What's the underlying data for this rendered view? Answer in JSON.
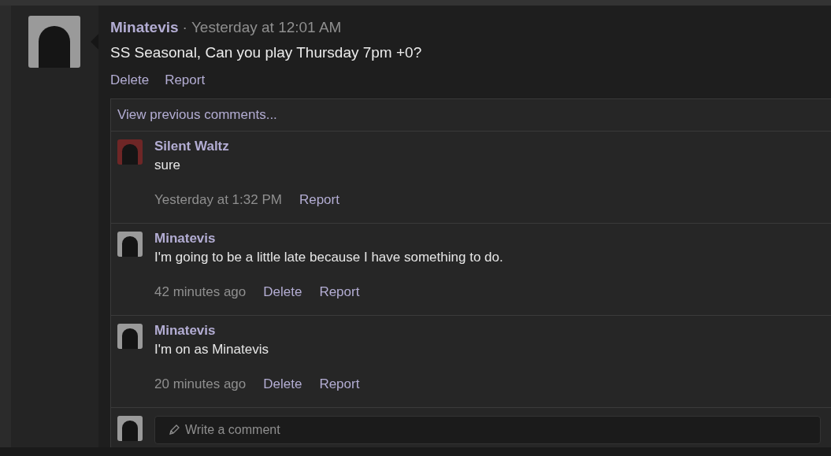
{
  "post": {
    "author": "Minatevis",
    "separator": "·",
    "time": "Yesterday at 12:01 AM",
    "text": "SS Seasonal, Can you play Thursday 7pm +0?",
    "actions": [
      "Delete",
      "Report"
    ]
  },
  "comments": {
    "view_previous": "View previous comments...",
    "items": [
      {
        "author": "Silent Waltz",
        "color": "#6e2626",
        "text": "sure",
        "time": "Yesterday at 1:32 PM",
        "actions": [
          "Report"
        ]
      },
      {
        "author": "Minatevis",
        "color": "#9a9a9a",
        "text": "I'm going to be a little late because I have something to do.",
        "time": "42 minutes ago",
        "actions": [
          "Delete",
          "Report"
        ]
      },
      {
        "author": "Minatevis",
        "color": "#9a9a9a",
        "text": "I'm on as Minatevis",
        "time": "20 minutes ago",
        "actions": [
          "Delete",
          "Report"
        ]
      }
    ],
    "compose": {
      "placeholder": "Write a comment"
    }
  }
}
